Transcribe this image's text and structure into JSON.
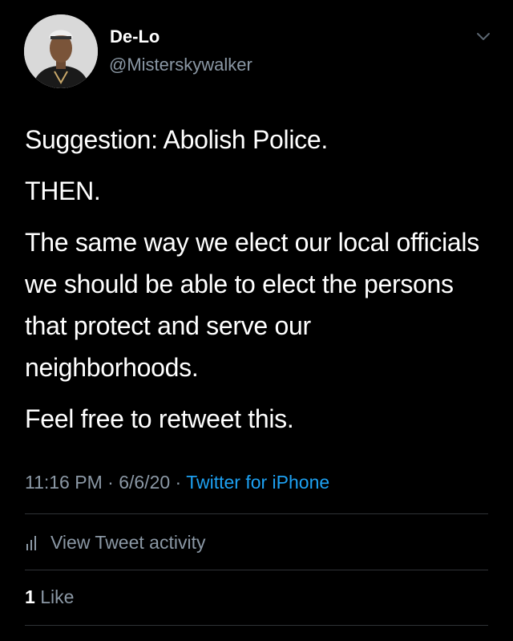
{
  "author": {
    "display_name": "De-Lo",
    "handle": "@Misterskywalker",
    "avatar_icon": "user-avatar"
  },
  "tweet": {
    "paragraphs": [
      "Suggestion: Abolish Police.",
      "THEN.",
      "The same way we elect our local officials we should be able to elect the persons that protect and serve our neighborhoods.",
      "Feel free to retweet this."
    ]
  },
  "meta": {
    "time": "11:16 PM",
    "separator": "·",
    "date": "6/6/20",
    "source": "Twitter for iPhone"
  },
  "activity": {
    "label": "View Tweet activity",
    "icon": "bar-chart-icon"
  },
  "likes": {
    "count": "1",
    "label": "Like"
  },
  "colors": {
    "background": "#000000",
    "text": "#ffffff",
    "secondary": "#8b98a5",
    "link": "#1da1f2",
    "divider": "#2f3336"
  }
}
